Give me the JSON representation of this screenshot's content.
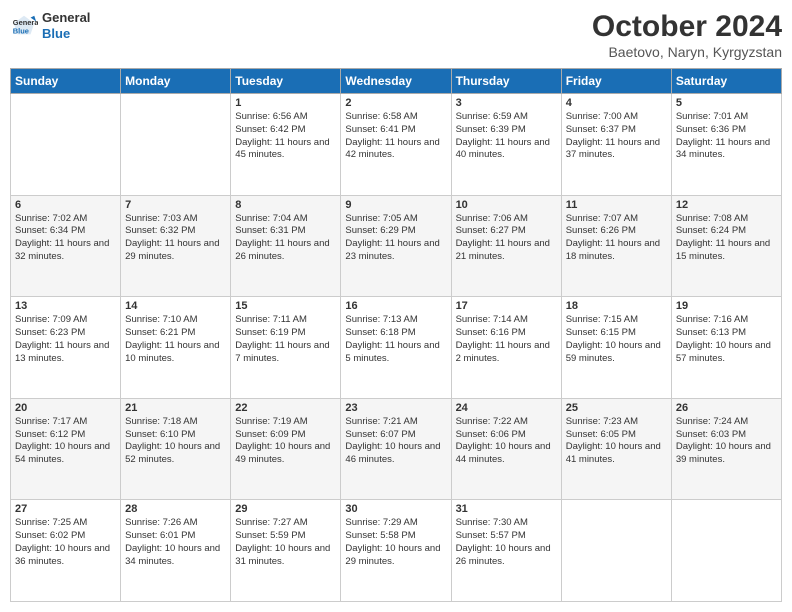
{
  "logo": {
    "line1": "General",
    "line2": "Blue"
  },
  "title": "October 2024",
  "subtitle": "Baetovo, Naryn, Kyrgyzstan",
  "days_header": [
    "Sunday",
    "Monday",
    "Tuesday",
    "Wednesday",
    "Thursday",
    "Friday",
    "Saturday"
  ],
  "weeks": [
    [
      {
        "num": "",
        "sunrise": "",
        "sunset": "",
        "daylight": ""
      },
      {
        "num": "",
        "sunrise": "",
        "sunset": "",
        "daylight": ""
      },
      {
        "num": "1",
        "sunrise": "Sunrise: 6:56 AM",
        "sunset": "Sunset: 6:42 PM",
        "daylight": "Daylight: 11 hours and 45 minutes."
      },
      {
        "num": "2",
        "sunrise": "Sunrise: 6:58 AM",
        "sunset": "Sunset: 6:41 PM",
        "daylight": "Daylight: 11 hours and 42 minutes."
      },
      {
        "num": "3",
        "sunrise": "Sunrise: 6:59 AM",
        "sunset": "Sunset: 6:39 PM",
        "daylight": "Daylight: 11 hours and 40 minutes."
      },
      {
        "num": "4",
        "sunrise": "Sunrise: 7:00 AM",
        "sunset": "Sunset: 6:37 PM",
        "daylight": "Daylight: 11 hours and 37 minutes."
      },
      {
        "num": "5",
        "sunrise": "Sunrise: 7:01 AM",
        "sunset": "Sunset: 6:36 PM",
        "daylight": "Daylight: 11 hours and 34 minutes."
      }
    ],
    [
      {
        "num": "6",
        "sunrise": "Sunrise: 7:02 AM",
        "sunset": "Sunset: 6:34 PM",
        "daylight": "Daylight: 11 hours and 32 minutes."
      },
      {
        "num": "7",
        "sunrise": "Sunrise: 7:03 AM",
        "sunset": "Sunset: 6:32 PM",
        "daylight": "Daylight: 11 hours and 29 minutes."
      },
      {
        "num": "8",
        "sunrise": "Sunrise: 7:04 AM",
        "sunset": "Sunset: 6:31 PM",
        "daylight": "Daylight: 11 hours and 26 minutes."
      },
      {
        "num": "9",
        "sunrise": "Sunrise: 7:05 AM",
        "sunset": "Sunset: 6:29 PM",
        "daylight": "Daylight: 11 hours and 23 minutes."
      },
      {
        "num": "10",
        "sunrise": "Sunrise: 7:06 AM",
        "sunset": "Sunset: 6:27 PM",
        "daylight": "Daylight: 11 hours and 21 minutes."
      },
      {
        "num": "11",
        "sunrise": "Sunrise: 7:07 AM",
        "sunset": "Sunset: 6:26 PM",
        "daylight": "Daylight: 11 hours and 18 minutes."
      },
      {
        "num": "12",
        "sunrise": "Sunrise: 7:08 AM",
        "sunset": "Sunset: 6:24 PM",
        "daylight": "Daylight: 11 hours and 15 minutes."
      }
    ],
    [
      {
        "num": "13",
        "sunrise": "Sunrise: 7:09 AM",
        "sunset": "Sunset: 6:23 PM",
        "daylight": "Daylight: 11 hours and 13 minutes."
      },
      {
        "num": "14",
        "sunrise": "Sunrise: 7:10 AM",
        "sunset": "Sunset: 6:21 PM",
        "daylight": "Daylight: 11 hours and 10 minutes."
      },
      {
        "num": "15",
        "sunrise": "Sunrise: 7:11 AM",
        "sunset": "Sunset: 6:19 PM",
        "daylight": "Daylight: 11 hours and 7 minutes."
      },
      {
        "num": "16",
        "sunrise": "Sunrise: 7:13 AM",
        "sunset": "Sunset: 6:18 PM",
        "daylight": "Daylight: 11 hours and 5 minutes."
      },
      {
        "num": "17",
        "sunrise": "Sunrise: 7:14 AM",
        "sunset": "Sunset: 6:16 PM",
        "daylight": "Daylight: 11 hours and 2 minutes."
      },
      {
        "num": "18",
        "sunrise": "Sunrise: 7:15 AM",
        "sunset": "Sunset: 6:15 PM",
        "daylight": "Daylight: 10 hours and 59 minutes."
      },
      {
        "num": "19",
        "sunrise": "Sunrise: 7:16 AM",
        "sunset": "Sunset: 6:13 PM",
        "daylight": "Daylight: 10 hours and 57 minutes."
      }
    ],
    [
      {
        "num": "20",
        "sunrise": "Sunrise: 7:17 AM",
        "sunset": "Sunset: 6:12 PM",
        "daylight": "Daylight: 10 hours and 54 minutes."
      },
      {
        "num": "21",
        "sunrise": "Sunrise: 7:18 AM",
        "sunset": "Sunset: 6:10 PM",
        "daylight": "Daylight: 10 hours and 52 minutes."
      },
      {
        "num": "22",
        "sunrise": "Sunrise: 7:19 AM",
        "sunset": "Sunset: 6:09 PM",
        "daylight": "Daylight: 10 hours and 49 minutes."
      },
      {
        "num": "23",
        "sunrise": "Sunrise: 7:21 AM",
        "sunset": "Sunset: 6:07 PM",
        "daylight": "Daylight: 10 hours and 46 minutes."
      },
      {
        "num": "24",
        "sunrise": "Sunrise: 7:22 AM",
        "sunset": "Sunset: 6:06 PM",
        "daylight": "Daylight: 10 hours and 44 minutes."
      },
      {
        "num": "25",
        "sunrise": "Sunrise: 7:23 AM",
        "sunset": "Sunset: 6:05 PM",
        "daylight": "Daylight: 10 hours and 41 minutes."
      },
      {
        "num": "26",
        "sunrise": "Sunrise: 7:24 AM",
        "sunset": "Sunset: 6:03 PM",
        "daylight": "Daylight: 10 hours and 39 minutes."
      }
    ],
    [
      {
        "num": "27",
        "sunrise": "Sunrise: 7:25 AM",
        "sunset": "Sunset: 6:02 PM",
        "daylight": "Daylight: 10 hours and 36 minutes."
      },
      {
        "num": "28",
        "sunrise": "Sunrise: 7:26 AM",
        "sunset": "Sunset: 6:01 PM",
        "daylight": "Daylight: 10 hours and 34 minutes."
      },
      {
        "num": "29",
        "sunrise": "Sunrise: 7:27 AM",
        "sunset": "Sunset: 5:59 PM",
        "daylight": "Daylight: 10 hours and 31 minutes."
      },
      {
        "num": "30",
        "sunrise": "Sunrise: 7:29 AM",
        "sunset": "Sunset: 5:58 PM",
        "daylight": "Daylight: 10 hours and 29 minutes."
      },
      {
        "num": "31",
        "sunrise": "Sunrise: 7:30 AM",
        "sunset": "Sunset: 5:57 PM",
        "daylight": "Daylight: 10 hours and 26 minutes."
      },
      {
        "num": "",
        "sunrise": "",
        "sunset": "",
        "daylight": ""
      },
      {
        "num": "",
        "sunrise": "",
        "sunset": "",
        "daylight": ""
      }
    ]
  ]
}
